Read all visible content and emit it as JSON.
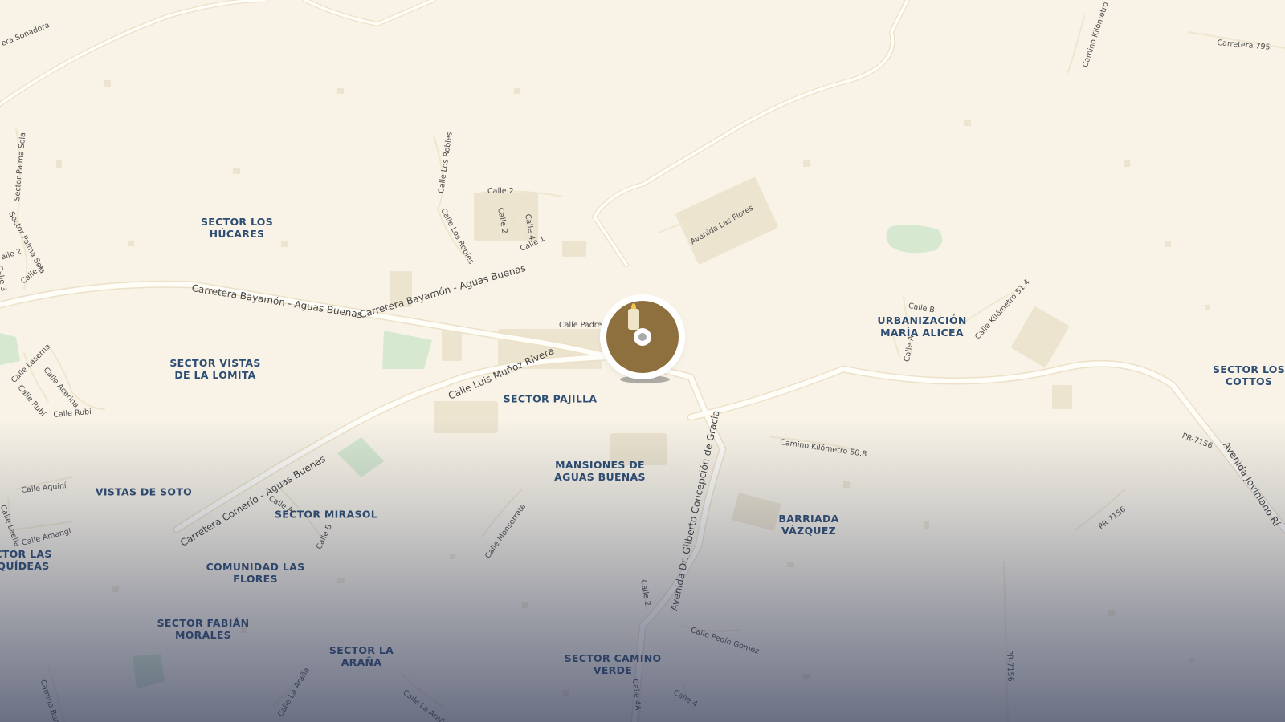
{
  "map": {
    "colors": {
      "land": "#f8f3e6",
      "road": "#fffdf7",
      "road_casing": "#ece1c8",
      "park": "#d6e8cf",
      "building": "#ece4cf",
      "area_label": "#2e4d73",
      "street_label": "#4d4d4d",
      "marker": "#8e703f"
    },
    "marker": {
      "icon": "memorial-candle-icon"
    },
    "area_labels": [
      {
        "lines": [
          "SECTOR LOS",
          "HÚCARES"
        ]
      },
      {
        "lines": [
          "SECTOR VISTAS",
          "DE LA LOMITA"
        ]
      },
      {
        "lines": [
          "SECTOR PAJILLA"
        ]
      },
      {
        "lines": [
          "MANSIONES DE",
          "AGUAS BUENAS"
        ]
      },
      {
        "lines": [
          "VISTAS DE SOTO"
        ]
      },
      {
        "lines": [
          "SECTOR MIRASOL"
        ]
      },
      {
        "lines": [
          "CTOR LAS",
          "QUÍDEAS"
        ]
      },
      {
        "lines": [
          "COMUNIDAD LAS",
          "FLORES"
        ]
      },
      {
        "lines": [
          "SECTOR FABIÁN",
          "MORALES"
        ]
      },
      {
        "lines": [
          "SECTOR LA",
          "ARAÑA"
        ]
      },
      {
        "lines": [
          "SECTOR CAMINO",
          "VERDE"
        ]
      },
      {
        "lines": [
          "BARRIADA",
          "VÁZQUEZ"
        ]
      },
      {
        "lines": [
          "URBANIZACIÓN",
          "MARÍA ALICEA"
        ]
      },
      {
        "lines": [
          "SECTOR LOS",
          "COTTOS"
        ]
      }
    ],
    "street_labels": [
      {
        "text": "era Sonadora"
      },
      {
        "text": "Carretera 795"
      },
      {
        "text": "Camino Kilómetro 8"
      },
      {
        "text": "Sector Palma Sola"
      },
      {
        "text": "Sector Palma Sola"
      },
      {
        "text": "Calle 1"
      },
      {
        "text": "alle 2"
      },
      {
        "text": "Calle 3"
      },
      {
        "text": "Calle Los Robles"
      },
      {
        "text": "Calle Los Robles"
      },
      {
        "text": "Calle 2"
      },
      {
        "text": "Calle 2"
      },
      {
        "text": "Calle 4"
      },
      {
        "text": "Calle 1"
      },
      {
        "text": "Avenida Las Flores"
      },
      {
        "text": "Carretera Bayamón - Aguas Buenas"
      },
      {
        "text": "Carretera Bayamón - Aguas Buenas"
      },
      {
        "text": "Calle Padre"
      },
      {
        "text": "Calle Luis Muñoz Rivera"
      },
      {
        "text": "Calle Laserna"
      },
      {
        "text": "Calle Acerina"
      },
      {
        "text": "Calle Rubí"
      },
      {
        "text": "Calle Rubí"
      },
      {
        "text": "Carretera Comerío - Aguas Buenas"
      },
      {
        "text": "Calle Aquiní"
      },
      {
        "text": "Calle Amangi"
      },
      {
        "text": "Calle Laelia"
      },
      {
        "text": "Calle A"
      },
      {
        "text": "Calle B"
      },
      {
        "text": "Calle Monserrate"
      },
      {
        "text": "Camino Kilómetro 50.8"
      },
      {
        "text": "Avenida Dr. Gilberto Concepción de Gracia"
      },
      {
        "text": "Calle 2"
      },
      {
        "text": "Calle Pepín Gómez"
      },
      {
        "text": "Calle 4A"
      },
      {
        "text": "Calle 4"
      },
      {
        "text": "Calle La Araña"
      },
      {
        "text": "Calle La Araña"
      },
      {
        "text": "Camino Bumb"
      },
      {
        "text": "Calle B"
      },
      {
        "text": "Calle A"
      },
      {
        "text": "Calle Kilómetro 51.4"
      },
      {
        "text": "PR-7156"
      },
      {
        "text": "PR-7156"
      },
      {
        "text": "PR-7156"
      },
      {
        "text": "Avenida Joviniano Rí"
      }
    ]
  }
}
